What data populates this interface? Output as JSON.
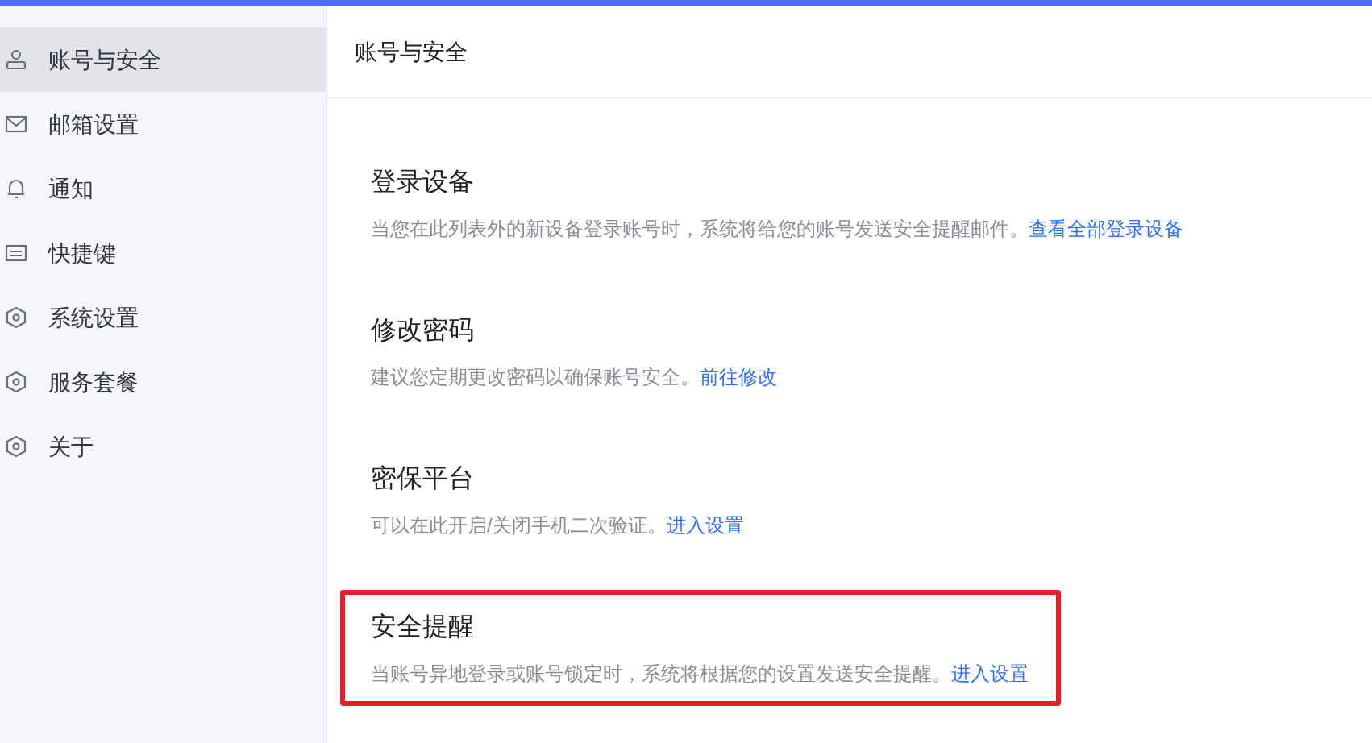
{
  "sidebar": {
    "items": [
      {
        "label": "账号与安全",
        "kind": "user",
        "selected": true
      },
      {
        "label": "邮箱设置",
        "kind": "mail",
        "selected": false
      },
      {
        "label": "通知",
        "kind": "bell",
        "selected": false
      },
      {
        "label": "快捷键",
        "kind": "keyboard",
        "selected": false
      },
      {
        "label": "系统设置",
        "kind": "hexagon",
        "selected": false
      },
      {
        "label": "服务套餐",
        "kind": "hexagon",
        "selected": false
      },
      {
        "label": "关于",
        "kind": "hexagon",
        "selected": false
      }
    ]
  },
  "header": {
    "title": "账号与安全"
  },
  "sections": [
    {
      "title": "登录设备",
      "description": "当您在此列表外的新设备登录账号时，系统将给您的账号发送安全提醒邮件。",
      "link": "查看全部登录设备",
      "highlighted": false
    },
    {
      "title": "修改密码",
      "description": "建议您定期更改密码以确保账号安全。",
      "link": "前往修改",
      "highlighted": false
    },
    {
      "title": "密保平台",
      "description": "可以在此开启/关闭手机二次验证。",
      "link": "进入设置",
      "highlighted": false
    },
    {
      "title": "安全提醒",
      "description": "当账号异地登录或账号锁定时，系统将根据您的设置发送安全提醒。",
      "link": "进入设置",
      "highlighted": true
    }
  ]
}
